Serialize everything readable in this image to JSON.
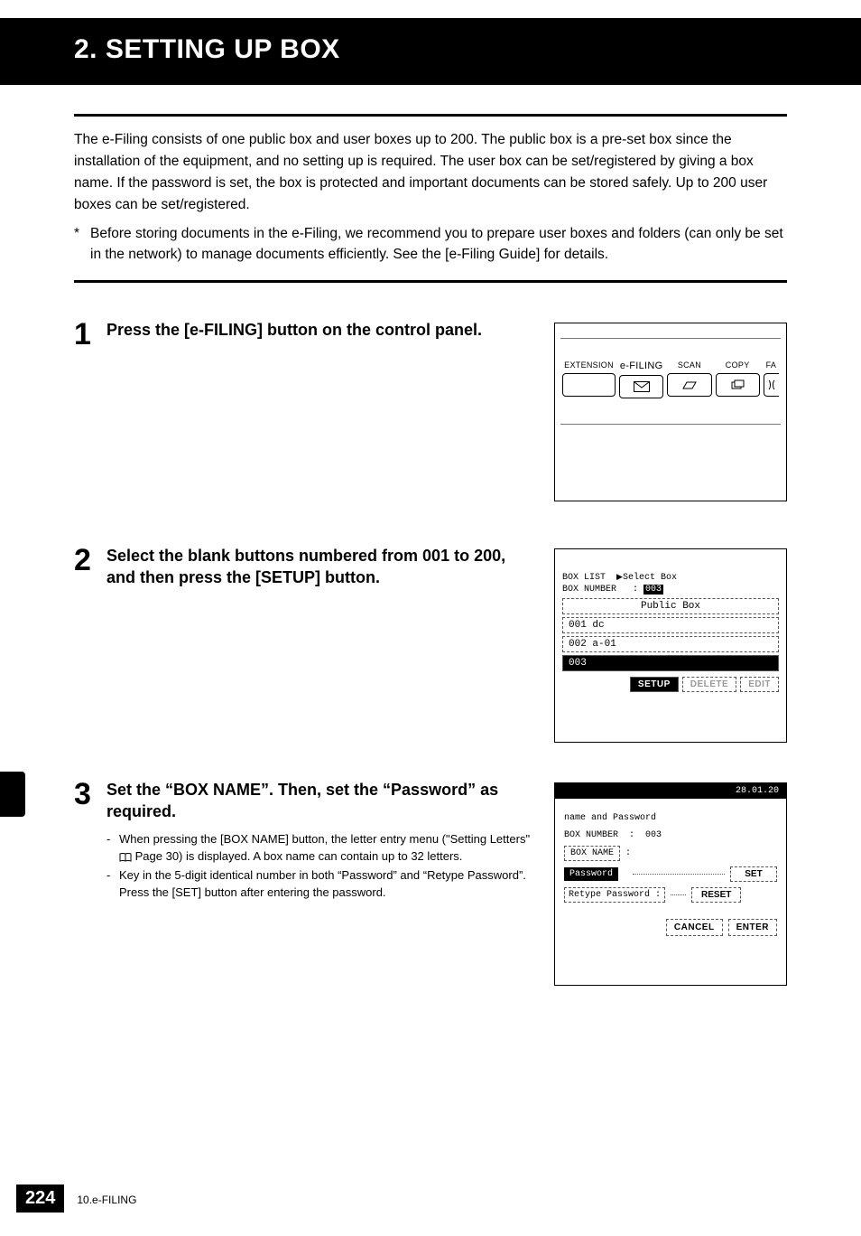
{
  "header": {
    "title": "2. SETTING UP BOX"
  },
  "intro": "The e-Filing consists of one public box and user boxes up to 200. The public box is a pre-set box since the installation of the equipment, and no setting up is required. The user box can be set/registered by giving a box name. If the password is set, the box is protected and important documents can be stored safely. Up to 200 user boxes can be set/registered.",
  "note_star": "*",
  "note": "Before storing documents in the e-Filing, we recommend you to prepare user boxes and folders (can only be set in the network) to manage documents efficiently. See the [e-Filing Guide] for details.",
  "steps": {
    "s1": {
      "num": "1",
      "title": "Press the [e-FILING] button on the control panel.",
      "fig": {
        "labels": {
          "extension": "EXTENSION",
          "efiling": "e-FILING",
          "scan": "SCAN",
          "copy": "COPY",
          "fax": "FA"
        }
      }
    },
    "s2": {
      "num": "2",
      "title": "Select the blank buttons numbered from 001 to 200, and then press the [SETUP] button.",
      "fig": {
        "header": "BOX LIST",
        "subheader": "Select Box",
        "boxnum_label": "BOX NUMBER",
        "boxnum_value": "003",
        "items": {
          "public": "Public Box",
          "i1": "001 dc",
          "i2": "002 a-01",
          "i3": "003"
        },
        "actions": {
          "setup": "SETUP",
          "delete": "DELETE",
          "edit": "EDIT"
        }
      }
    },
    "s3": {
      "num": "3",
      "title": "Set the “BOX NAME”. Then, set the “Password” as required.",
      "sub1_a": "When pressing the [BOX NAME] button, the letter entry menu (\"Setting Letters\" ",
      "sub1_b": " Page 30) is displayed. A box name can contain up to 32 letters.",
      "sub2": "Key in the 5-digit identical number in both “Password” and “Retype Password”. Press the [SET] button after entering the password.",
      "fig": {
        "date": "28.01.20",
        "title": "name and Password",
        "boxnum_label": "BOX NUMBER",
        "boxnum_value": "003",
        "boxname": "BOX NAME",
        "password": "Password",
        "retype": "Retype Password",
        "set": "SET",
        "reset": "RESET",
        "cancel": "CANCEL",
        "enter": "ENTER"
      }
    }
  },
  "footer": {
    "page": "224",
    "section": "10.e-FILING"
  }
}
